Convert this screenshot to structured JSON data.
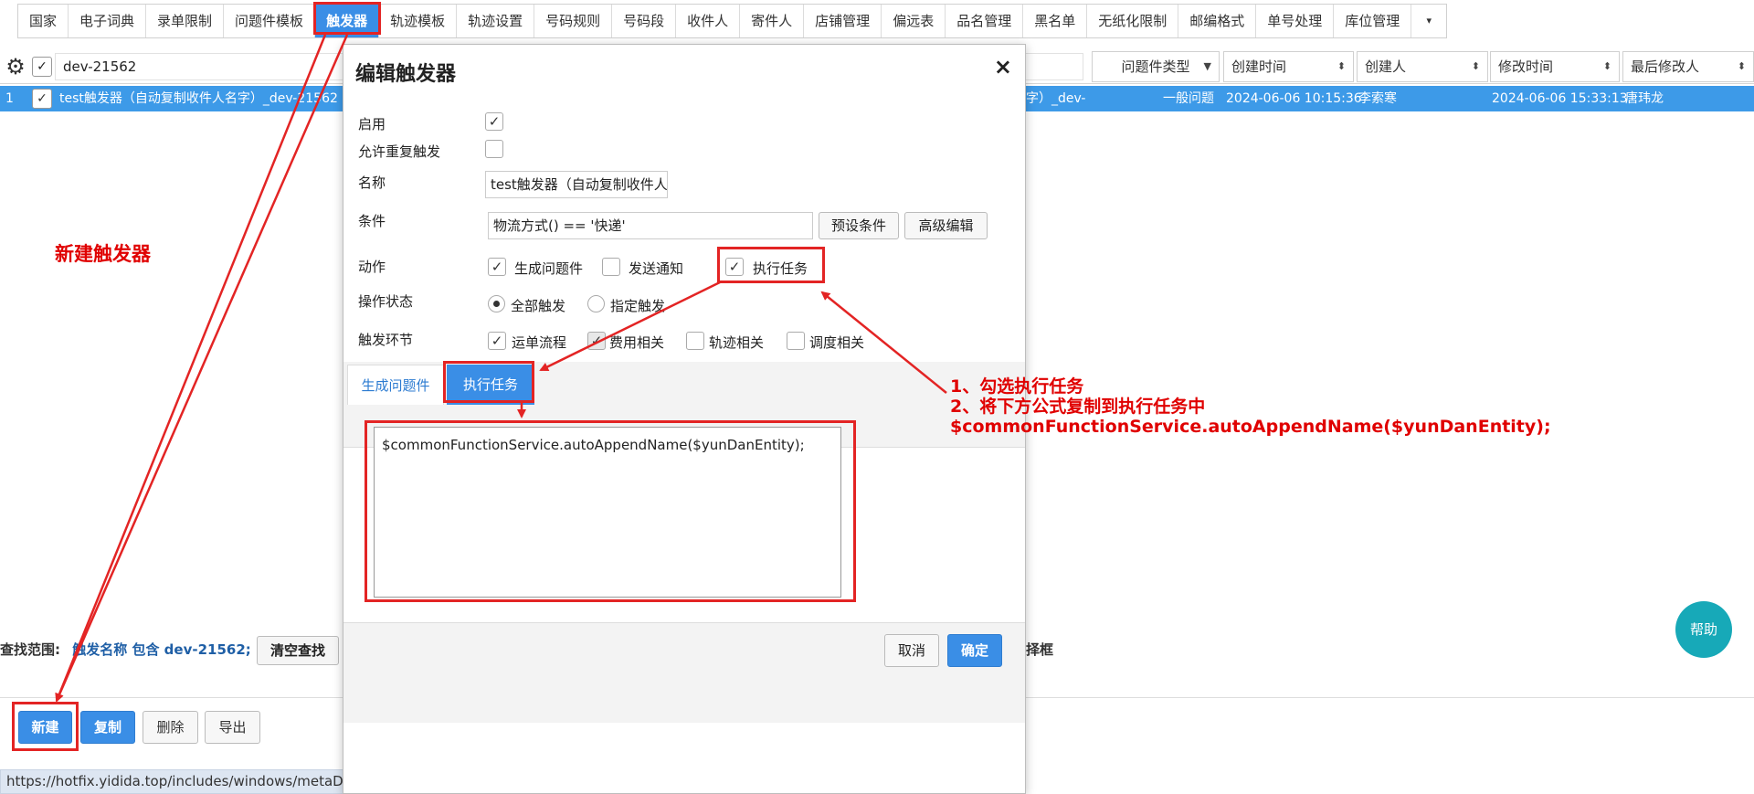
{
  "tabs": [
    {
      "label": "国家",
      "active": false
    },
    {
      "label": "电子词典",
      "active": false
    },
    {
      "label": "录单限制",
      "active": false
    },
    {
      "label": "问题件模板",
      "active": false
    },
    {
      "label": "触发器",
      "active": true
    },
    {
      "label": "轨迹模板",
      "active": false
    },
    {
      "label": "轨迹设置",
      "active": false
    },
    {
      "label": "号码规则",
      "active": false
    },
    {
      "label": "号码段",
      "active": false
    },
    {
      "label": "收件人",
      "active": false
    },
    {
      "label": "寄件人",
      "active": false
    },
    {
      "label": "店铺管理",
      "active": false
    },
    {
      "label": "偏远表",
      "active": false
    },
    {
      "label": "品名管理",
      "active": false
    },
    {
      "label": "黑名单",
      "active": false
    },
    {
      "label": "无纸化限制",
      "active": false
    },
    {
      "label": "邮编格式",
      "active": false
    },
    {
      "label": "单号处理",
      "active": false
    },
    {
      "label": "库位管理",
      "active": false
    }
  ],
  "tabs_more": "▾",
  "table": {
    "filter_value": "dev-21562",
    "columns": [
      "问题件类型",
      "创建时间",
      "创建人",
      "修改时间",
      "最后修改人"
    ],
    "row": {
      "index": "1",
      "name": "test触发器（自动复制收件人名字）_dev-21562",
      "name_tail": "字）_dev-",
      "problem_type": "一般问题",
      "created_at": "2024-06-06 10:15:36",
      "creator": "李索寒",
      "modified_at": "2024-06-06 15:33:13",
      "last_modifier": "唐玮龙"
    }
  },
  "modal": {
    "title": "编辑触发器",
    "close": "×",
    "labels": {
      "enabled": "启用",
      "allow_repeat": "允许重复触发",
      "name": "名称",
      "condition": "条件",
      "action": "动作",
      "op_status": "操作状态",
      "trigger_stage": "触发环节"
    },
    "name_value": "test触发器（自动复制收件人:",
    "condition_value": "物流方式() == '快递'",
    "preset_button": "预设条件",
    "advanced_button": "高级编辑",
    "actions": [
      "生成问题件",
      "发送通知",
      "执行任务"
    ],
    "op_options": [
      "全部触发",
      "指定触发"
    ],
    "stages": [
      "运单流程",
      "费用相关",
      "轨迹相关",
      "调度相关"
    ],
    "subtabs": [
      "生成问题件",
      "执行任务"
    ],
    "script": "$commonFunctionService.autoAppendName($yunDanEntity);",
    "cancel": "取消",
    "ok": "确定"
  },
  "search": {
    "prefix": "查找范围:",
    "condition": "触发名称 包含 dev-21562;",
    "clear": "清空查找",
    "tail": "使用选择框"
  },
  "buttons": {
    "new": "新建",
    "copy": "复制",
    "delete": "删除",
    "export": "导出"
  },
  "status_url": "https://hotfix.yidida.top/includes/windows/metaData/metaData.xhtml?businessType...",
  "help": "帮助",
  "annotations": {
    "new_trigger": "新建触发器",
    "steps": "1、勾选执行任务\n2、将下方公式复制到执行任务中\n$commonFunctionService.autoAppendName($yunDanEntity);"
  },
  "colors": {
    "accent": "#3a8ee6",
    "annotation": "#e32424",
    "help": "#17a9b8"
  }
}
